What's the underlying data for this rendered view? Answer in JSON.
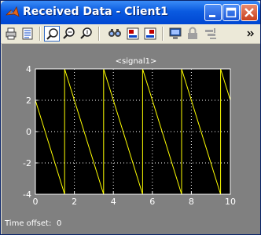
{
  "window": {
    "title": "Received Data - Client1"
  },
  "scope": {
    "title": "<signal1>",
    "status_label": "Time offset:",
    "time_offset": "0"
  },
  "colors": {
    "plot_bg": "#000000",
    "frame_bg": "#808080",
    "trace": "#ffff00",
    "grid": "#ffffff"
  },
  "toolbar": {
    "icons": [
      "print-icon",
      "parameters-icon",
      "zoom-icon",
      "zoom-x-icon",
      "zoom-y-icon",
      "autoscale-icon",
      "save-axes-icon",
      "restore-axes-icon",
      "floating-scope-icon",
      "lock-icon",
      "signal-selection-icon"
    ]
  },
  "chart_data": {
    "type": "line",
    "title": "<signal1>",
    "xlim": [
      0,
      10
    ],
    "ylim": [
      -4,
      4
    ],
    "xticks": [
      "0",
      "2",
      "4",
      "6",
      "8",
      "10"
    ],
    "yticks": [
      "4",
      "2",
      "0",
      "-2",
      "-4"
    ],
    "grid": true,
    "series": [
      {
        "x": [
          0,
          0,
          1.5,
          1.5,
          3.5,
          3.5,
          5.5,
          5.5,
          7.5,
          7.5,
          9.5,
          9.5,
          10
        ],
        "y": [
          0,
          2,
          -4,
          4,
          -4,
          4,
          -4,
          4,
          -4,
          4,
          -4,
          4,
          2
        ]
      }
    ]
  }
}
